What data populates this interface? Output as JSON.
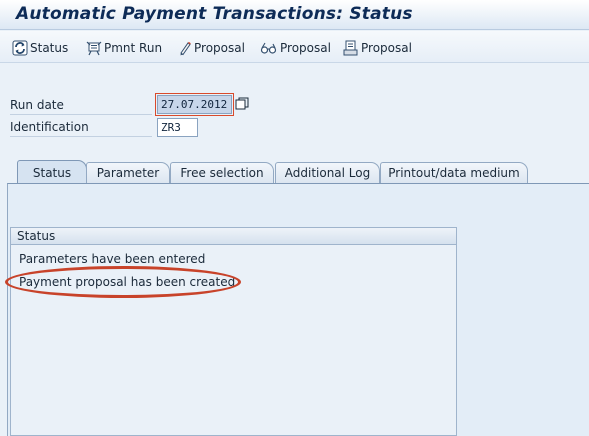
{
  "window": {
    "title": "Automatic Payment Transactions: Status"
  },
  "toolbar": {
    "items": [
      {
        "label": "Status",
        "icon": "refresh-status-icon"
      },
      {
        "label": "Pmnt Run",
        "icon": "payment-run-icon"
      },
      {
        "label": "Proposal",
        "icon": "pencil-edit-icon"
      },
      {
        "label": "Proposal",
        "icon": "glasses-display-icon"
      },
      {
        "label": "Proposal",
        "icon": "document-print-icon"
      }
    ]
  },
  "form": {
    "run_date": {
      "label": "Run date",
      "value": "27.07.2012",
      "focused": true
    },
    "identification": {
      "label": "Identification",
      "value": "ZR3"
    }
  },
  "tabs": [
    {
      "label": "Status",
      "active": true
    },
    {
      "label": "Parameter",
      "active": false
    },
    {
      "label": "Free selection",
      "active": false
    },
    {
      "label": "Additional Log",
      "active": false
    },
    {
      "label": "Printout/data medium",
      "active": false
    }
  ],
  "status_group": {
    "title": "Status",
    "lines": [
      "Parameters have been entered",
      "Payment proposal has been created"
    ]
  },
  "colors": {
    "highlight": "#c8432a",
    "title_text": "#0d2b57",
    "background": "#eaf1f8"
  }
}
